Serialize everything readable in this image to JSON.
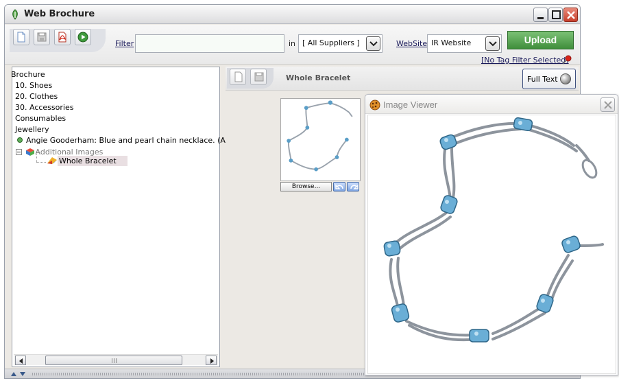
{
  "window": {
    "title": "Web Brochure"
  },
  "toolbar": {
    "filter_label": "Filter",
    "filter_value": "",
    "in_label": "in",
    "supplier_value": "[ All Suppliers ]",
    "website_label": "WebSite",
    "website_value": "IR Website",
    "upload_label": "Upload",
    "tag_filter_label": "[No Tag Filter Selected]"
  },
  "tree": {
    "items": [
      {
        "label": "Brochure"
      },
      {
        "label": "10. Shoes"
      },
      {
        "label": "20. Clothes"
      },
      {
        "label": "30. Accessories"
      },
      {
        "label": "Consumables"
      },
      {
        "label": "Jewellery"
      },
      {
        "label": "Angie Gooderham: Blue and pearl chain necklace. (Alstons"
      },
      {
        "label": "Additional Images"
      },
      {
        "label": "Whole Bracelet"
      }
    ]
  },
  "detail": {
    "title": "Whole Bracelet",
    "full_text_label": "Full Text",
    "browse_label": "Browse..."
  },
  "image_viewer": {
    "title": "Image Viewer"
  },
  "colors": {
    "upload_bg": "#4f9c4a",
    "gem": "#5a9ec7",
    "selection": "#e9dfe2"
  }
}
